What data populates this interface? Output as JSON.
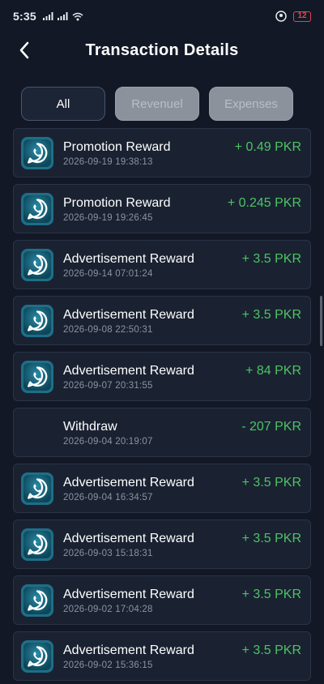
{
  "status_bar": {
    "time": "5:35",
    "battery": "12"
  },
  "header": {
    "title": "Transaction Details"
  },
  "tabs": [
    {
      "label": "All",
      "active": true
    },
    {
      "label": "Revenuel",
      "active": false
    },
    {
      "label": "Expenses",
      "active": false
    }
  ],
  "colors": {
    "background": "#121826",
    "card": "#1a2232",
    "amount": "#4cc462",
    "icon_bg": "#1e6f88"
  },
  "transactions": [
    {
      "name": "Promotion Reward",
      "date": "2026-09-19 19:38:13",
      "amount": "+ 0.49 PKR",
      "icon": "whatsapp-icon"
    },
    {
      "name": "Promotion Reward",
      "date": "2026-09-19 19:26:45",
      "amount": "+ 0.245 PKR",
      "icon": "whatsapp-icon"
    },
    {
      "name": "Advertisement Reward",
      "date": "2026-09-14 07:01:24",
      "amount": "+ 3.5 PKR",
      "icon": "whatsapp-icon"
    },
    {
      "name": "Advertisement Reward",
      "date": "2026-09-08 22:50:31",
      "amount": "+ 3.5 PKR",
      "icon": "whatsapp-icon"
    },
    {
      "name": "Advertisement Reward",
      "date": "2026-09-07 20:31:55",
      "amount": "+ 84 PKR",
      "icon": "whatsapp-icon"
    },
    {
      "name": "Withdraw",
      "date": "2026-09-04 20:19:07",
      "amount": "- 207 PKR",
      "icon": ""
    },
    {
      "name": "Advertisement Reward",
      "date": "2026-09-04 16:34:57",
      "amount": "+ 3.5 PKR",
      "icon": "whatsapp-icon"
    },
    {
      "name": "Advertisement Reward",
      "date": "2026-09-03 15:18:31",
      "amount": "+ 3.5 PKR",
      "icon": "whatsapp-icon"
    },
    {
      "name": "Advertisement Reward",
      "date": "2026-09-02 17:04:28",
      "amount": "+ 3.5 PKR",
      "icon": "whatsapp-icon"
    },
    {
      "name": "Advertisement Reward",
      "date": "2026-09-02 15:36:15",
      "amount": "+ 3.5 PKR",
      "icon": "whatsapp-icon"
    }
  ]
}
